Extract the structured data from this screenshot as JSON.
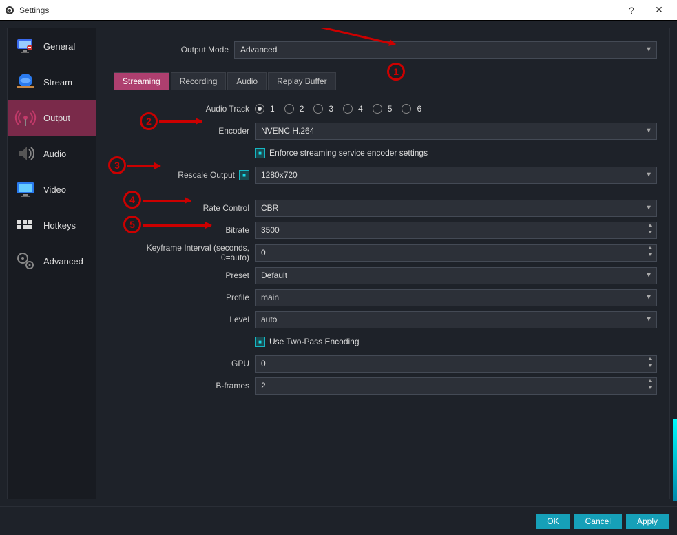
{
  "window": {
    "title": "Settings"
  },
  "titlebar_buttons": {
    "help": "?",
    "close": "✕"
  },
  "sidebar": {
    "items": [
      {
        "label": "General"
      },
      {
        "label": "Stream"
      },
      {
        "label": "Output"
      },
      {
        "label": "Audio"
      },
      {
        "label": "Video"
      },
      {
        "label": "Hotkeys"
      },
      {
        "label": "Advanced"
      }
    ]
  },
  "tabs": [
    {
      "label": "Streaming"
    },
    {
      "label": "Recording"
    },
    {
      "label": "Audio"
    },
    {
      "label": "Replay Buffer"
    }
  ],
  "labels": {
    "output_mode": "Output Mode",
    "audio_track": "Audio Track",
    "encoder": "Encoder",
    "enforce": "Enforce streaming service encoder settings",
    "rescale": "Rescale Output",
    "rate_control": "Rate Control",
    "bitrate": "Bitrate",
    "keyframe": "Keyframe Interval (seconds, 0=auto)",
    "preset": "Preset",
    "profile": "Profile",
    "level": "Level",
    "two_pass": "Use Two-Pass Encoding",
    "gpu": "GPU",
    "bframes": "B-frames"
  },
  "values": {
    "output_mode": "Advanced",
    "encoder": "NVENC H.264",
    "rescale": "1280x720",
    "rate_control": "CBR",
    "bitrate": "3500",
    "keyframe": "0",
    "preset": "Default",
    "profile": "main",
    "level": "auto",
    "gpu": "0",
    "bframes": "2"
  },
  "audio_tracks": [
    "1",
    "2",
    "3",
    "4",
    "5",
    "6"
  ],
  "checkboxes": {
    "enforce": true,
    "rescale": true,
    "two_pass": true
  },
  "footer": {
    "ok": "OK",
    "cancel": "Cancel",
    "apply": "Apply"
  },
  "annotations": [
    "1",
    "2",
    "3",
    "4",
    "5"
  ]
}
